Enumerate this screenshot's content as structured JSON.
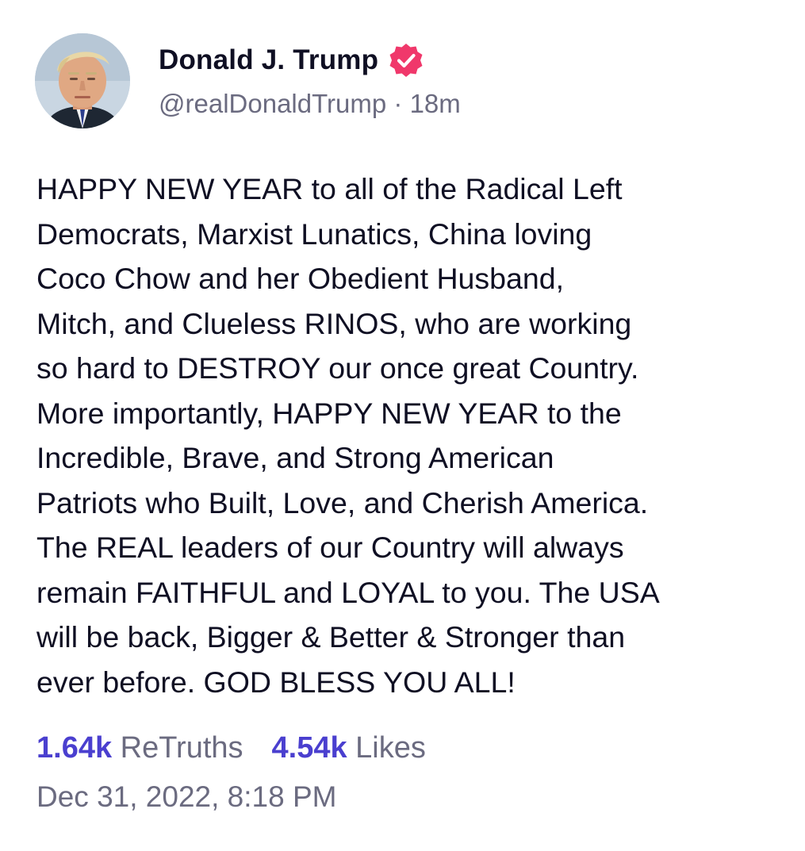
{
  "post": {
    "display_name": "Donald J. Trump",
    "handle": "@realDonaldTrump",
    "separator": " · ",
    "relative_time": "18m",
    "verified_icon": "verified-badge-icon",
    "verified_color": "#f0386b",
    "text": "HAPPY NEW YEAR to all of the Radical Left\nDemocrats, Marxist Lunatics, China loving\nCoco Chow and her Obedient Husband,\nMitch, and Clueless RINOS, who are working\nso hard to DESTROY our once great Country.\nMore importantly, HAPPY NEW YEAR to the\nIncredible, Brave, and Strong American\nPatriots who Built, Love, and Cherish America.\nThe REAL leaders of our Country will always\nremain FAITHFUL and LOYAL to you. The USA\nwill be back, Bigger & Better & Stronger than\never before. GOD BLESS YOU ALL!",
    "stats": {
      "retruths_count": "1.64k",
      "retruths_label": "ReTruths",
      "likes_count": "4.54k",
      "likes_label": "Likes"
    },
    "timestamp": "Dec 31, 2022, 8:18 PM"
  },
  "colors": {
    "accent": "#4a3fcf",
    "muted_text": "#6b6b80",
    "primary_text": "#0f0f23",
    "verified_badge": "#f0386b"
  }
}
